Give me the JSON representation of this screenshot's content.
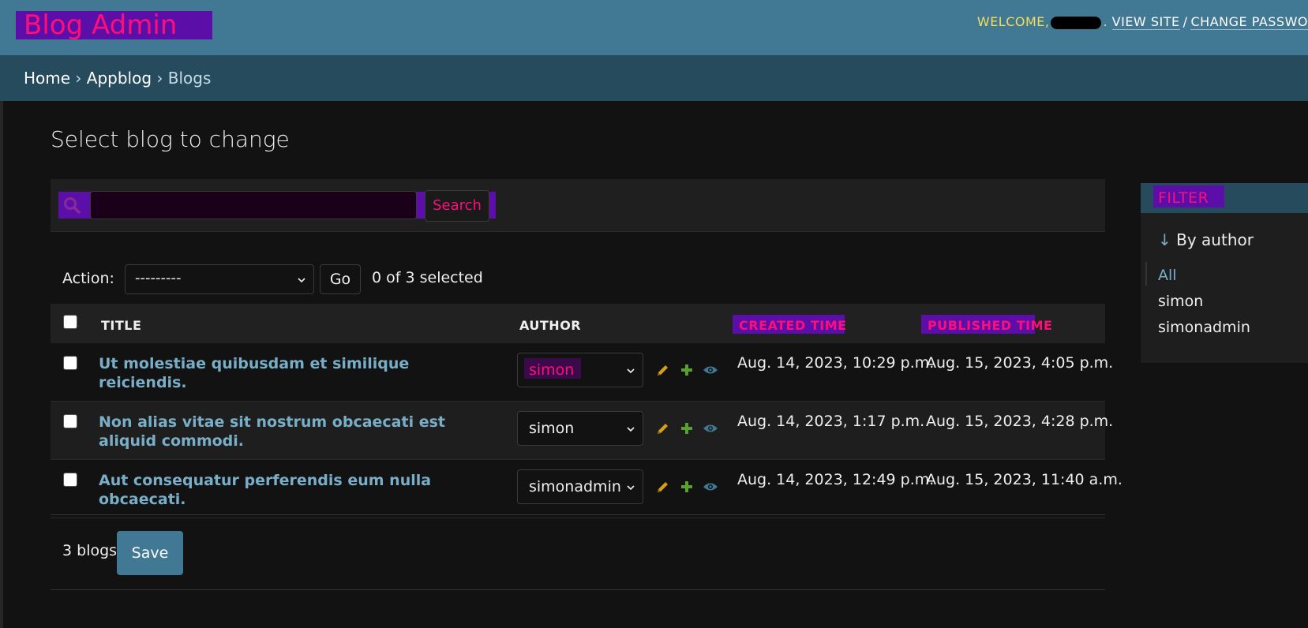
{
  "header": {
    "site_name": "Blog Admin",
    "welcome": "WELCOME,",
    "view_site": "VIEW SITE",
    "separator": "/",
    "change_password": "CHANGE PASSWO"
  },
  "breadcrumbs": {
    "home": "Home",
    "app": "Appblog",
    "current": "Blogs",
    "sep": "›"
  },
  "page": {
    "title": "Select blog to change"
  },
  "search": {
    "button": "Search",
    "placeholder": ""
  },
  "actions": {
    "label": "Action:",
    "selected_value": "---------",
    "go": "Go",
    "selected_count": "0 of 3 selected"
  },
  "table": {
    "headers": {
      "title": "TITLE",
      "author": "AUTHOR",
      "created": "CREATED TIME",
      "published": "PUBLISHED TIME"
    },
    "rows": [
      {
        "title": "Ut molestiae quibusdam et similique reiciendis.",
        "author": "simon",
        "created": "Aug. 14, 2023, 10:29 p.m.",
        "published": "Aug. 15, 2023, 4:05 p.m."
      },
      {
        "title": "Non alias vitae sit nostrum obcaecati est aliquid commodi.",
        "author": "simon",
        "created": "Aug. 14, 2023, 1:17 p.m.",
        "published": "Aug. 15, 2023, 4:28 p.m."
      },
      {
        "title": "Aut consequatur perferendis eum nulla obcaecati.",
        "author": "simonadmin",
        "created": "Aug. 14, 2023, 12:49 p.m.",
        "published": "Aug. 15, 2023, 11:40 a.m."
      }
    ]
  },
  "footer": {
    "count": "3 blogs",
    "save": "Save"
  },
  "filter": {
    "title": "FILTER",
    "by_arrow": "↓",
    "by_label": "By author",
    "options": [
      "All",
      "simon",
      "simonadmin"
    ]
  },
  "colors": {
    "header_bg": "#417893",
    "breadcrumb_bg": "#264b5d",
    "link": "#79aec8",
    "highlight_bg": "#5b0ea8",
    "highlight_text": "#ff0e7a",
    "edit_icon": "#d4a017",
    "add_icon": "#5aa02c",
    "view_icon": "#417893"
  },
  "icons": [
    "search-icon",
    "chevron-down-icon",
    "pencil-icon",
    "plus-icon",
    "eye-icon"
  ]
}
